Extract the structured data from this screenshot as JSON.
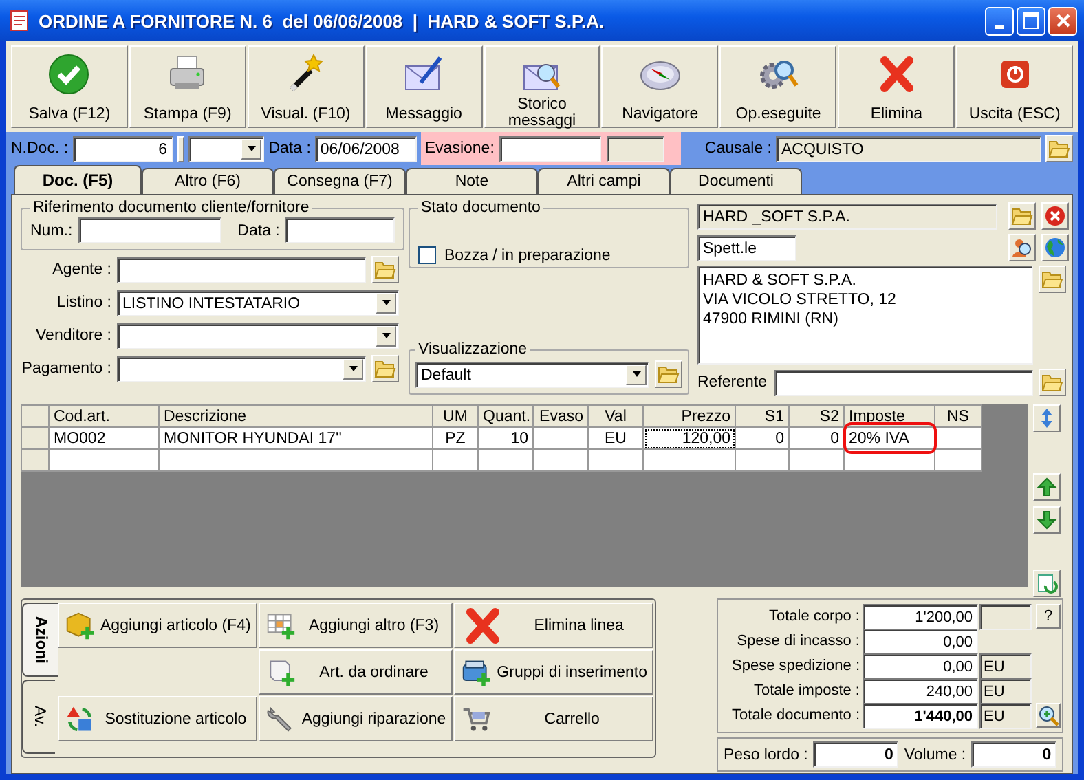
{
  "window": {
    "title": "ORDINE A FORNITORE N. 6  del 06/06/2008  |  HARD & SOFT S.P.A."
  },
  "toolbar": [
    {
      "label": "Salva (F12)"
    },
    {
      "label": "Stampa (F9)"
    },
    {
      "label": "Visual. (F10)"
    },
    {
      "label": "Messaggio"
    },
    {
      "label": "Storico messaggi"
    },
    {
      "label": "Navigatore"
    },
    {
      "label": "Op.eseguite"
    },
    {
      "label": "Elimina"
    },
    {
      "label": "Uscita (ESC)"
    }
  ],
  "header": {
    "ndoc": {
      "label": "N.Doc. :",
      "value": "6"
    },
    "data": {
      "label": "Data :",
      "value": "06/06/2008"
    },
    "evasione": {
      "label": "Evasione:"
    },
    "causale": {
      "label": "Causale :",
      "value": "ACQUISTO"
    }
  },
  "tabs": [
    {
      "label": "Doc. (F5)",
      "selected": true
    },
    {
      "label": "Altro (F6)",
      "selected": false
    },
    {
      "label": "Consegna (F7)",
      "selected": false
    },
    {
      "label": "Note",
      "selected": false
    },
    {
      "label": "Altri campi",
      "selected": false
    },
    {
      "label": "Documenti",
      "selected": false
    }
  ],
  "riferimento": {
    "title": "Riferimento documento cliente/fornitore",
    "num_label": "Num.:",
    "data_label": "Data :"
  },
  "fields": [
    {
      "label": "Agente :",
      "kind": "lookup"
    },
    {
      "label": "Listino :",
      "kind": "combo",
      "value": "LISTINO INTESTATARIO"
    },
    {
      "label": "Venditore :",
      "kind": "combo"
    },
    {
      "label": "Pagamento :",
      "kind": "combo-lookup"
    }
  ],
  "stato": {
    "title": "Stato documento",
    "checkbox": {
      "label": "Bozza / in preparazione",
      "checked": false
    }
  },
  "visualizzazione": {
    "title": "Visualizzazione",
    "value": "Default"
  },
  "cliente": {
    "name": "HARD _SOFT S.P.A.",
    "salutation": "Spett.le",
    "address": [
      "HARD & SOFT S.P.A.",
      "VIA VICOLO STRETTO, 12",
      "47900 RIMINI (RN)"
    ],
    "referente_label": "Referente"
  },
  "table": {
    "columns": [
      {
        "label": "Cod.art."
      },
      {
        "label": "Descrizione"
      },
      {
        "label": "UM"
      },
      {
        "label": "Quant."
      },
      {
        "label": "Evaso"
      },
      {
        "label": "Val"
      },
      {
        "label": "Prezzo"
      },
      {
        "label": "S1"
      },
      {
        "label": "S2"
      },
      {
        "label": "Imposte"
      },
      {
        "label": "NS"
      }
    ],
    "rows": [
      {
        "cells": [
          {
            "text": "MO002"
          },
          {
            "text": "MONITOR HYUNDAI 17''"
          },
          {
            "text": "PZ"
          },
          {
            "text": "10"
          },
          {},
          {
            "text": "EU"
          },
          {
            "text": "120,00",
            "focused": true
          },
          {
            "text": "0"
          },
          {
            "text": "0"
          },
          {
            "text": "20% IVA",
            "circled": true
          },
          {}
        ]
      }
    ]
  },
  "actions": {
    "tabs": [
      {
        "label": "Azioni",
        "selected": true
      },
      {
        "label": "Av.",
        "selected": false
      }
    ],
    "buttons": [
      {
        "kind": "button",
        "label": "Aggiungi articolo (F4)"
      },
      {
        "kind": "button",
        "label": "Aggiungi altro (F3)"
      },
      {
        "kind": "button",
        "label": "Elimina linea"
      },
      {
        "kind": "blank"
      },
      {
        "kind": "button",
        "label": "Art. da ordinare"
      },
      {
        "kind": "button",
        "label": "Gruppi di inserimento"
      },
      {
        "kind": "button",
        "label": "Sostituzione articolo"
      },
      {
        "kind": "button",
        "label": "Aggiungi riparazione"
      },
      {
        "kind": "button",
        "label": "Carrello"
      }
    ]
  },
  "totals": [
    {
      "label": "Totale corpo :",
      "value": "1'200,00",
      "unit_field": true,
      "bold": false,
      "button": {
        "kind": "help",
        "label": "?"
      }
    },
    {
      "label": "Spese di incasso :",
      "value": "0,00",
      "unit_field": false,
      "bold": false
    },
    {
      "label": "Spese spedizione :",
      "value": "0,00",
      "unit_field": true,
      "unit": "EU",
      "bold": false
    },
    {
      "label": "Totale imposte :",
      "value": "240,00",
      "unit_field": true,
      "unit": "EU",
      "bold": false
    },
    {
      "label": "Totale documento :",
      "value": "1'440,00",
      "unit_field": true,
      "unit": "EU",
      "bold": true,
      "button": {
        "kind": "zoom"
      }
    }
  ],
  "weights": [
    {
      "label": "Peso lordo :",
      "value": "0"
    },
    {
      "label": "Volume :",
      "value": "0"
    }
  ]
}
